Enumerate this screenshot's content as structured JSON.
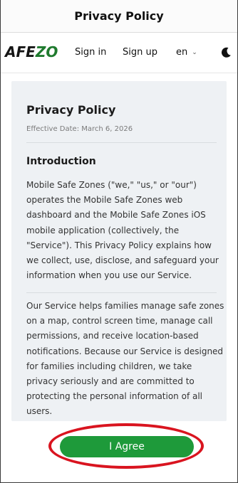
{
  "header": {
    "title": "Privacy Policy"
  },
  "nav": {
    "logo_prefix": "AFE",
    "logo_suffix": "ZO",
    "sign_in": "Sign in",
    "sign_up": "Sign up",
    "language": "en",
    "theme_icon": "moon-icon"
  },
  "policy": {
    "title": "Privacy Policy",
    "effective_date": "Effective Date: March 6, 2026",
    "section_title": "Introduction",
    "paragraph1": "Mobile Safe Zones (\"we,\" \"us,\" or \"our\") operates the Mobile Safe Zones web dashboard and the Mobile Safe Zones iOS mobile application (collectively, the \"Service\"). This Privacy Policy explains how we collect, use, disclose, and safeguard your information when you use our Service.",
    "paragraph2": "Our Service helps families manage safe zones on a map, control screen time, manage call permissions, and receive location-based notifications. Because our Service is designed for families including children, we take privacy seriously and are committed to protecting the personal information of all users."
  },
  "actions": {
    "agree_label": "I Agree"
  },
  "colors": {
    "accent": "#1e9a3a",
    "highlight": "#d9141f",
    "content_bg": "#eef1f4"
  }
}
